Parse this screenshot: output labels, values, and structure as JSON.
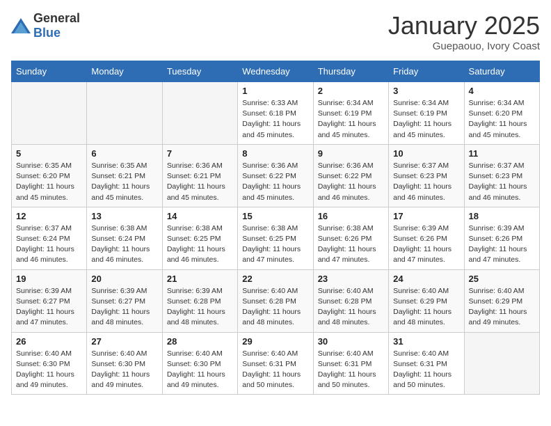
{
  "logo": {
    "general": "General",
    "blue": "Blue"
  },
  "title": "January 2025",
  "subtitle": "Guepaouo, Ivory Coast",
  "days_of_week": [
    "Sunday",
    "Monday",
    "Tuesday",
    "Wednesday",
    "Thursday",
    "Friday",
    "Saturday"
  ],
  "weeks": [
    [
      {
        "day": "",
        "info": ""
      },
      {
        "day": "",
        "info": ""
      },
      {
        "day": "",
        "info": ""
      },
      {
        "day": "1",
        "info": "Sunrise: 6:33 AM\nSunset: 6:18 PM\nDaylight: 11 hours and 45 minutes."
      },
      {
        "day": "2",
        "info": "Sunrise: 6:34 AM\nSunset: 6:19 PM\nDaylight: 11 hours and 45 minutes."
      },
      {
        "day": "3",
        "info": "Sunrise: 6:34 AM\nSunset: 6:19 PM\nDaylight: 11 hours and 45 minutes."
      },
      {
        "day": "4",
        "info": "Sunrise: 6:34 AM\nSunset: 6:20 PM\nDaylight: 11 hours and 45 minutes."
      }
    ],
    [
      {
        "day": "5",
        "info": "Sunrise: 6:35 AM\nSunset: 6:20 PM\nDaylight: 11 hours and 45 minutes."
      },
      {
        "day": "6",
        "info": "Sunrise: 6:35 AM\nSunset: 6:21 PM\nDaylight: 11 hours and 45 minutes."
      },
      {
        "day": "7",
        "info": "Sunrise: 6:36 AM\nSunset: 6:21 PM\nDaylight: 11 hours and 45 minutes."
      },
      {
        "day": "8",
        "info": "Sunrise: 6:36 AM\nSunset: 6:22 PM\nDaylight: 11 hours and 45 minutes."
      },
      {
        "day": "9",
        "info": "Sunrise: 6:36 AM\nSunset: 6:22 PM\nDaylight: 11 hours and 46 minutes."
      },
      {
        "day": "10",
        "info": "Sunrise: 6:37 AM\nSunset: 6:23 PM\nDaylight: 11 hours and 46 minutes."
      },
      {
        "day": "11",
        "info": "Sunrise: 6:37 AM\nSunset: 6:23 PM\nDaylight: 11 hours and 46 minutes."
      }
    ],
    [
      {
        "day": "12",
        "info": "Sunrise: 6:37 AM\nSunset: 6:24 PM\nDaylight: 11 hours and 46 minutes."
      },
      {
        "day": "13",
        "info": "Sunrise: 6:38 AM\nSunset: 6:24 PM\nDaylight: 11 hours and 46 minutes."
      },
      {
        "day": "14",
        "info": "Sunrise: 6:38 AM\nSunset: 6:25 PM\nDaylight: 11 hours and 46 minutes."
      },
      {
        "day": "15",
        "info": "Sunrise: 6:38 AM\nSunset: 6:25 PM\nDaylight: 11 hours and 47 minutes."
      },
      {
        "day": "16",
        "info": "Sunrise: 6:38 AM\nSunset: 6:26 PM\nDaylight: 11 hours and 47 minutes."
      },
      {
        "day": "17",
        "info": "Sunrise: 6:39 AM\nSunset: 6:26 PM\nDaylight: 11 hours and 47 minutes."
      },
      {
        "day": "18",
        "info": "Sunrise: 6:39 AM\nSunset: 6:26 PM\nDaylight: 11 hours and 47 minutes."
      }
    ],
    [
      {
        "day": "19",
        "info": "Sunrise: 6:39 AM\nSunset: 6:27 PM\nDaylight: 11 hours and 47 minutes."
      },
      {
        "day": "20",
        "info": "Sunrise: 6:39 AM\nSunset: 6:27 PM\nDaylight: 11 hours and 48 minutes."
      },
      {
        "day": "21",
        "info": "Sunrise: 6:39 AM\nSunset: 6:28 PM\nDaylight: 11 hours and 48 minutes."
      },
      {
        "day": "22",
        "info": "Sunrise: 6:40 AM\nSunset: 6:28 PM\nDaylight: 11 hours and 48 minutes."
      },
      {
        "day": "23",
        "info": "Sunrise: 6:40 AM\nSunset: 6:28 PM\nDaylight: 11 hours and 48 minutes."
      },
      {
        "day": "24",
        "info": "Sunrise: 6:40 AM\nSunset: 6:29 PM\nDaylight: 11 hours and 48 minutes."
      },
      {
        "day": "25",
        "info": "Sunrise: 6:40 AM\nSunset: 6:29 PM\nDaylight: 11 hours and 49 minutes."
      }
    ],
    [
      {
        "day": "26",
        "info": "Sunrise: 6:40 AM\nSunset: 6:30 PM\nDaylight: 11 hours and 49 minutes."
      },
      {
        "day": "27",
        "info": "Sunrise: 6:40 AM\nSunset: 6:30 PM\nDaylight: 11 hours and 49 minutes."
      },
      {
        "day": "28",
        "info": "Sunrise: 6:40 AM\nSunset: 6:30 PM\nDaylight: 11 hours and 49 minutes."
      },
      {
        "day": "29",
        "info": "Sunrise: 6:40 AM\nSunset: 6:31 PM\nDaylight: 11 hours and 50 minutes."
      },
      {
        "day": "30",
        "info": "Sunrise: 6:40 AM\nSunset: 6:31 PM\nDaylight: 11 hours and 50 minutes."
      },
      {
        "day": "31",
        "info": "Sunrise: 6:40 AM\nSunset: 6:31 PM\nDaylight: 11 hours and 50 minutes."
      },
      {
        "day": "",
        "info": ""
      }
    ]
  ]
}
